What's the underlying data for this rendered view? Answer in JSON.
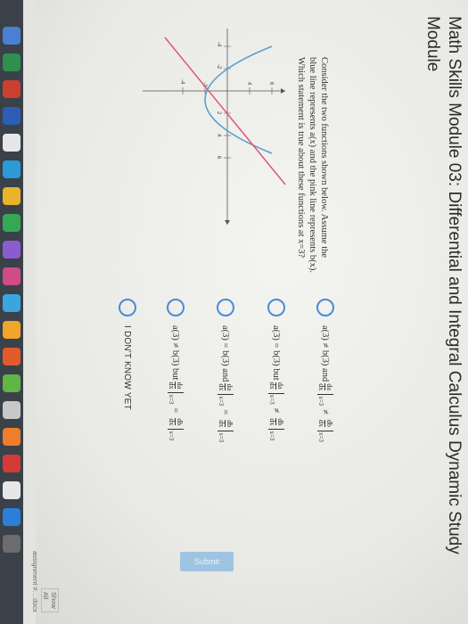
{
  "title": "Math Skills Module 03: Differential and Integral Calculus Dynamic Study Module",
  "question": {
    "line1": "Consider the two functions shown below. Assume the",
    "line2": "blue line represents a(x) and the pink line represents b(x).",
    "line3": "Which statement is true about these functions at x=3?"
  },
  "graph": {
    "y_ticks": [
      "6",
      "4",
      "2",
      "-2",
      "-4"
    ],
    "x_ticks": [
      "-4",
      "-2",
      "2",
      "4",
      "6"
    ],
    "blue_color": "#5aa0cf",
    "pink_color": "#e0506e"
  },
  "options": [
    {
      "lhs": "a(3) ≠ b(3) and",
      "rel": "≠",
      "fa_num": "da",
      "fb_num": "db",
      "den": "dx",
      "sub": "x=3"
    },
    {
      "lhs": "a(3) = b(3) but",
      "rel": "≠",
      "fa_num": "da",
      "fb_num": "db",
      "den": "dx",
      "sub": "x=3"
    },
    {
      "lhs": "a(3) = b(3) and",
      "rel": "=",
      "fa_num": "da",
      "fb_num": "db",
      "den": "dx",
      "sub": "x=3"
    },
    {
      "lhs": "a(3) ≠ b(3) but",
      "rel": "=",
      "fa_num": "da",
      "fb_num": "db",
      "den": "dx",
      "sub": "x=3"
    },
    {
      "plain": "I DON'T KNOW YET"
    }
  ],
  "submit_label": "Submit",
  "download": {
    "file": "assignment #....docx",
    "show_all": "Show All"
  }
}
